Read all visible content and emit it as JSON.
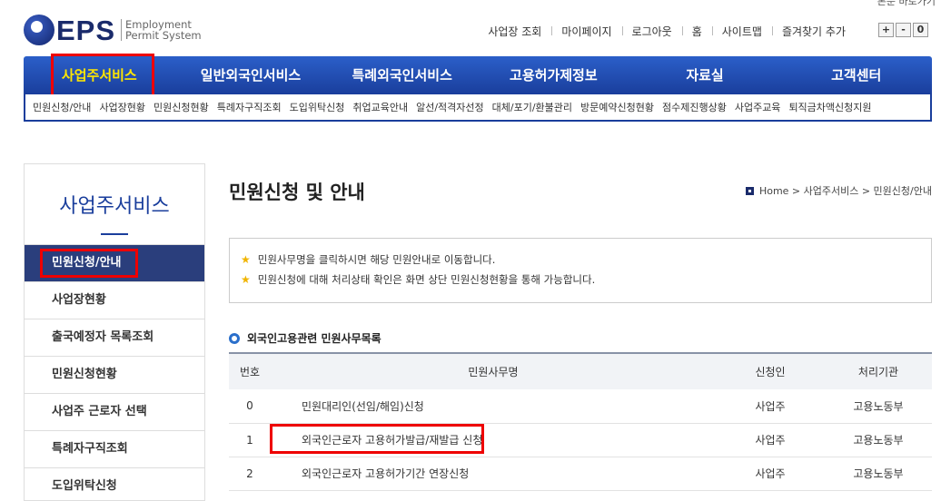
{
  "top_cut_text": "본문 바로가기",
  "logo": {
    "text": "EPS",
    "sub_line1": "Employment",
    "sub_line2": "Permit System"
  },
  "util_nav": [
    "사업장 조회",
    "마이페이지",
    "로그아웃",
    "홈",
    "사이트맵",
    "즐겨찾기 추가"
  ],
  "zoom": [
    "+",
    "-",
    "0"
  ],
  "gnb": [
    "사업주서비스",
    "일반외국인서비스",
    "특례외국인서비스",
    "고용허가제정보",
    "자료실",
    "고객센터"
  ],
  "subnav": [
    "민원신청/안내",
    "사업장현황",
    "민원신청현황",
    "특례자구직조회",
    "도입위탁신청",
    "취업교육안내",
    "알선/적격자선정",
    "대체/포기/환불관리",
    "방문예약신청현황",
    "점수제진행상황",
    "사업주교육",
    "퇴직금차액신청지원"
  ],
  "lnb": {
    "title": "사업주서비스",
    "items": [
      "민원신청/안내",
      "사업장현황",
      "출국예정자 목록조회",
      "민원신청현황",
      "사업주 근로자 선택",
      "특례자구직조회",
      "도입위탁신청"
    ]
  },
  "page_title": "민원신청 및 안내",
  "breadcrumb": "Home > 사업주서비스 > 민원신청/안내",
  "notice": [
    "민원사무명을 클릭하시면 해당 민원안내로 이동합니다.",
    "민원신청에 대해 처리상태 확인은 화면 상단 민원신청현황을 통해 가능합니다."
  ],
  "section_title": "외국인고용관련 민원사무목록",
  "table": {
    "headers": [
      "번호",
      "민원사무명",
      "신청인",
      "처리기관"
    ],
    "rows": [
      [
        "0",
        "민원대리인(선임/해임)신청",
        "사업주",
        "고용노동부"
      ],
      [
        "1",
        "외국인근로자 고용허가발급/재발급 신청",
        "사업주",
        "고용노동부"
      ],
      [
        "2",
        "외국인근로자 고용허가기간 연장신청",
        "사업주",
        "고용노동부"
      ]
    ]
  },
  "colors": {
    "brand": "#1a3e9c",
    "highlight": "#ee0000",
    "active_menu_text": "#ffe600",
    "lnb_active": "#2a3e7c"
  }
}
